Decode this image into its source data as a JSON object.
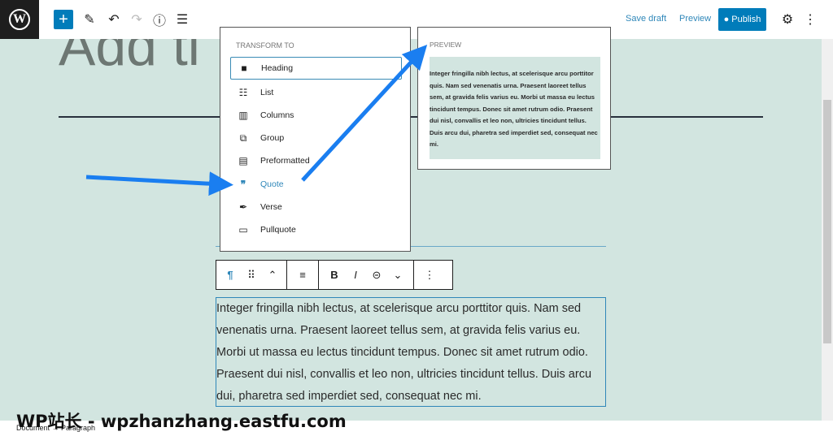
{
  "header": {
    "add_label": "+",
    "save_draft": "Save draft",
    "preview": "Preview",
    "publish": "Publish"
  },
  "post_title": "Add ti",
  "transform_menu": {
    "heading": "TRANSFORM TO",
    "items": [
      {
        "label": "Heading",
        "icon": "bookmark-icon"
      },
      {
        "label": "List",
        "icon": "list-icon"
      },
      {
        "label": "Columns",
        "icon": "columns-icon"
      },
      {
        "label": "Group",
        "icon": "group-icon"
      },
      {
        "label": "Preformatted",
        "icon": "preformatted-icon"
      },
      {
        "label": "Quote",
        "icon": "quote-icon"
      },
      {
        "label": "Verse",
        "icon": "feather-icon"
      },
      {
        "label": "Pullquote",
        "icon": "pullquote-icon"
      }
    ]
  },
  "preview_panel": {
    "heading": "PREVIEW",
    "text": "Integer fringilla nibh lectus, at scelerisque arcu porttitor quis. Nam sed venenatis urna. Praesent laoreet tellus sem, at gravida felis varius eu. Morbi ut massa eu lectus tincidunt tempus. Donec sit amet rutrum odio. Praesent dui nisl, convallis et leo non, ultricies tincidunt tellus. Duis arcu dui, pharetra sed imperdiet sed, consequat nec mi."
  },
  "paragraph": "Integer fringilla nibh lectus, at scelerisque arcu porttitor quis. Nam sed venenatis urna. Praesent laoreet tellus sem, at gravida felis varius eu. Morbi ut massa eu lectus tincidunt tempus. Donec sit amet rutrum odio. Praesent dui nisl, convallis et leo non, ultricies tincidunt tellus. Duis arcu dui, pharetra sed imperdiet sed, consequat nec mi.",
  "breadcrumb": "Document → Paragraph",
  "watermark": "WP站长 - wpzhanzhang.eastfu.com",
  "colors": {
    "accent": "#007cba",
    "canvas": "#d2e5e0",
    "arrow": "#1a7ef0"
  }
}
